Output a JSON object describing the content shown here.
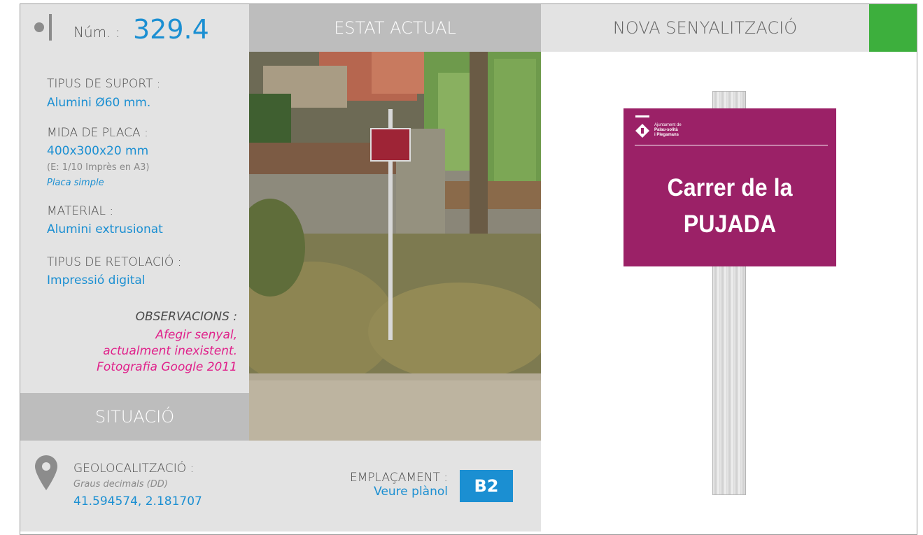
{
  "header": {
    "num_label": "Núm. :",
    "num_value": "329.4",
    "estat_actual": "ESTAT ACTUAL",
    "nova_senyalitzacio": "NOVA SENYALITZACIÓ"
  },
  "specs": {
    "tipus_suport_label": "TIPUS DE SUPORT :",
    "tipus_suport_value": "Alumini Ø60 mm.",
    "mida_placa_label": "MIDA DE PLACA :",
    "mida_placa_value": "400x300x20 mm",
    "mida_placa_note": "(E: 1/10 Imprès en A3)",
    "mida_placa_type": "Placa simple",
    "material_label": "MATERIAL :",
    "material_value": "Alumini extrusionat",
    "retolacio_label": "TIPUS DE RETOLACIÓ :",
    "retolacio_value": "Impressió digital",
    "observacions_label": "OBSERVACIONS :",
    "observacions_line1": "Afegir senyal,",
    "observacions_line2": "actualment inexistent.",
    "observacions_line3": "Fotografia Google 2011"
  },
  "situacio": {
    "title": "SITUACIÓ",
    "geo_label": "GEOLOCALITZACIÓ :",
    "geo_note": "Graus decimals (DD)",
    "geo_value": "41.594574, 2.181707",
    "emplacament_label": "EMPLAÇAMENT :",
    "emplacament_value": "Veure plànol",
    "emplacament_code": "B2"
  },
  "new_sign": {
    "logo_line1": "Ajuntament de",
    "logo_line2": "Palau-solità",
    "logo_line3": "i Plegamans",
    "line1": "Carrer de la",
    "line2": "PUJADA"
  },
  "colors": {
    "accent_blue": "#1b8fd2",
    "observacions_pink": "#e0208a",
    "sign_magenta": "#9b2167",
    "status_green": "#3daf3d",
    "header_gray": "#bdbdbd",
    "panel_gray": "#e3e3e3"
  }
}
